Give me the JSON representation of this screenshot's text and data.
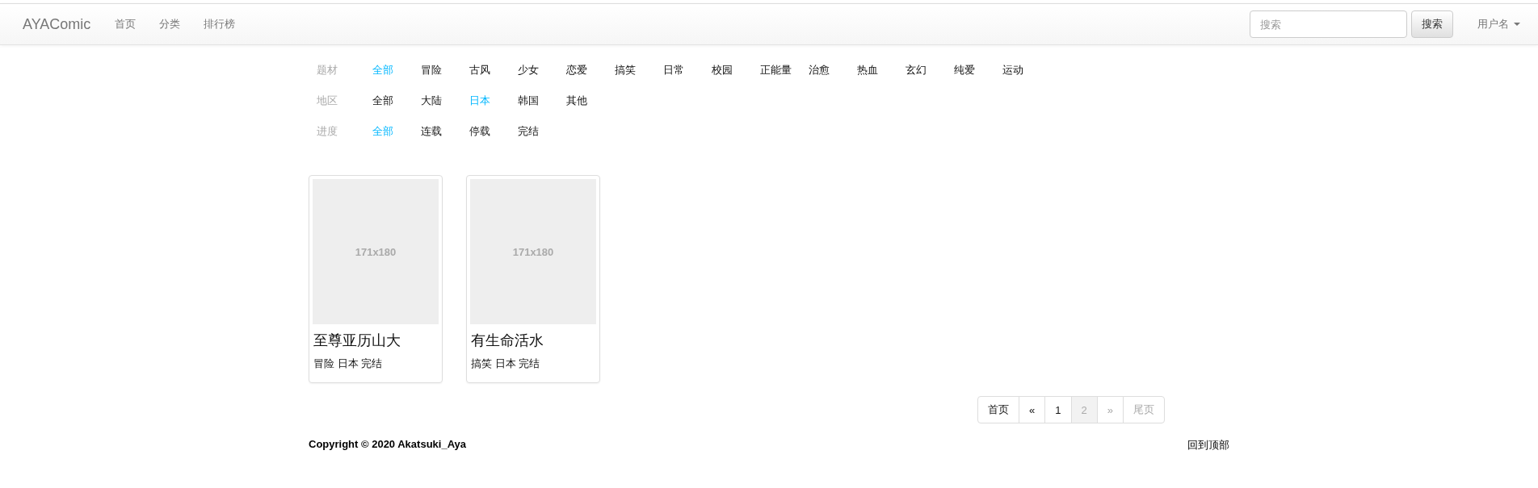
{
  "navbar": {
    "brand": "AYAComic",
    "links": [
      "首页",
      "分类",
      "排行榜"
    ],
    "search": {
      "placeholder": "搜索",
      "button": "搜索"
    },
    "user_menu": "用户名"
  },
  "filters": [
    {
      "label": "题材",
      "options": [
        {
          "text": "全部",
          "selected": true
        },
        {
          "text": "冒险",
          "selected": false
        },
        {
          "text": "古风",
          "selected": false
        },
        {
          "text": "少女",
          "selected": false
        },
        {
          "text": "恋爱",
          "selected": false
        },
        {
          "text": "搞笑",
          "selected": false
        },
        {
          "text": "日常",
          "selected": false
        },
        {
          "text": "校园",
          "selected": false
        },
        {
          "text": "正能量",
          "selected": false
        },
        {
          "text": "治愈",
          "selected": false
        },
        {
          "text": "热血",
          "selected": false
        },
        {
          "text": "玄幻",
          "selected": false
        },
        {
          "text": "纯爱",
          "selected": false
        },
        {
          "text": "运动",
          "selected": false
        }
      ]
    },
    {
      "label": "地区",
      "options": [
        {
          "text": "全部",
          "selected": false
        },
        {
          "text": "大陆",
          "selected": false
        },
        {
          "text": "日本",
          "selected": true
        },
        {
          "text": "韩国",
          "selected": false
        },
        {
          "text": "其他",
          "selected": false
        }
      ]
    },
    {
      "label": "进度",
      "options": [
        {
          "text": "全部",
          "selected": true
        },
        {
          "text": "连载",
          "selected": false
        },
        {
          "text": "停载",
          "selected": false
        },
        {
          "text": "完结",
          "selected": false
        }
      ]
    }
  ],
  "comics": [
    {
      "image_label": "171x180",
      "title": "至尊亚历山大",
      "tags": "冒险 日本 完结"
    },
    {
      "image_label": "171x180",
      "title": "有生命活水",
      "tags": "搞笑 日本 完结"
    }
  ],
  "pagination": [
    {
      "text": "首页",
      "selected": false,
      "disabled": false
    },
    {
      "text": "«",
      "selected": false,
      "disabled": false
    },
    {
      "text": "1",
      "selected": false,
      "disabled": false
    },
    {
      "text": "2",
      "selected": true,
      "disabled": false
    },
    {
      "text": "»",
      "selected": false,
      "disabled": true
    },
    {
      "text": "尾页",
      "selected": false,
      "disabled": true
    }
  ],
  "footer": {
    "copyright": "Copyright © 2020 Akatsuki_Aya",
    "back_to_top": "回到顶部"
  }
}
